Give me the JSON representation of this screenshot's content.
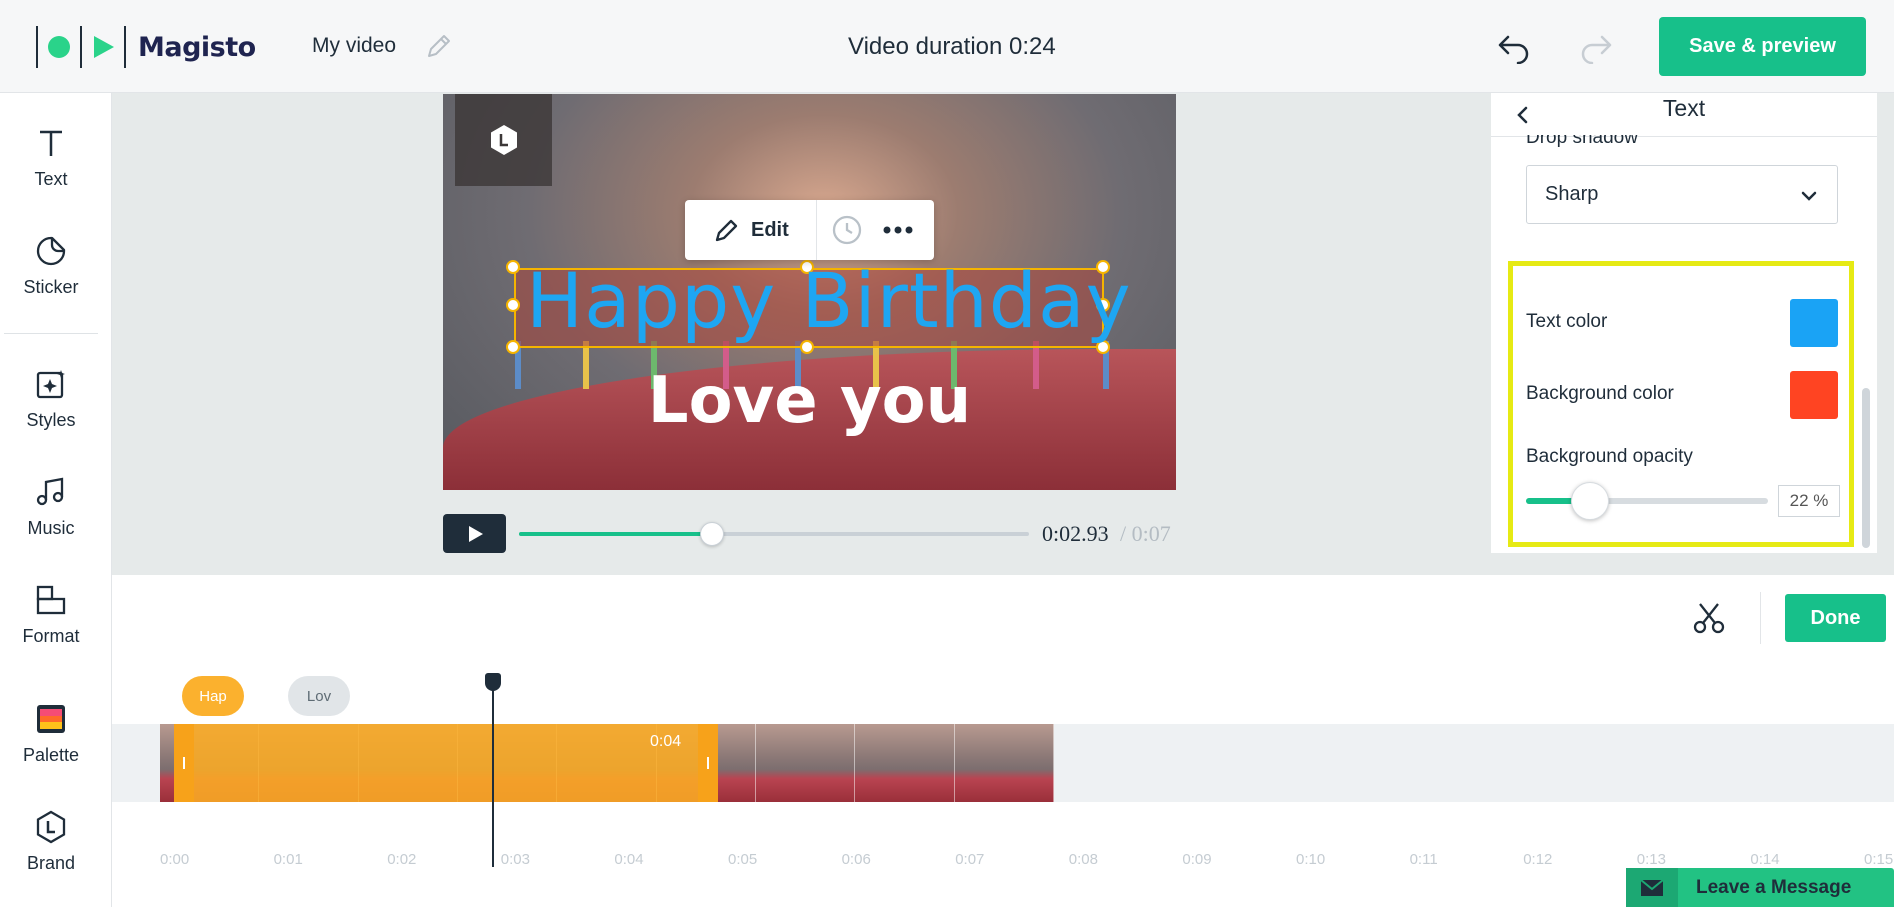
{
  "header": {
    "brand": "Magisto",
    "video_title": "My video",
    "duration": "Video duration 0:24",
    "save_label": "Save & preview",
    "accent": "#17c08a"
  },
  "toolbar": {
    "items": [
      {
        "label": "Text",
        "icon": "text-icon"
      },
      {
        "label": "Sticker",
        "icon": "sticker-icon"
      },
      {
        "label": "Styles",
        "icon": "styles-icon"
      },
      {
        "label": "Music",
        "icon": "music-icon"
      },
      {
        "label": "Format",
        "icon": "format-icon"
      },
      {
        "label": "Palette",
        "icon": "palette-icon"
      },
      {
        "label": "Brand",
        "icon": "brand-icon"
      }
    ]
  },
  "preview": {
    "edit_label": "Edit",
    "main_text": "Happy Birthday",
    "secondary_text": "Love you",
    "current_time": "0:02.93",
    "total_time": " / 0:07",
    "progress": 0.38
  },
  "panel": {
    "title": "Text",
    "drop_shadow_label": "Drop shadow",
    "drop_shadow_value": "Sharp",
    "text_color_label": "Text color",
    "text_color": "#1aa3f5",
    "background_color_label": "Background color",
    "background_color": "#ff4422",
    "background_opacity_label": "Background opacity",
    "background_opacity": "22",
    "percent_sign": "%"
  },
  "timeline": {
    "done_label": "Done",
    "clips": [
      {
        "label": "Hap",
        "color": "#fbb12e"
      },
      {
        "label": "Lov",
        "color": "#e1e5e8"
      }
    ],
    "selected_clip_duration": "0:04",
    "ruler": [
      "0:00",
      "0:01",
      "0:02",
      "0:03",
      "0:04",
      "0:05",
      "0:06",
      "0:07",
      "0:08",
      "0:09",
      "0:10",
      "0:11",
      "0:12",
      "0:13",
      "0:14",
      "0:15"
    ]
  },
  "chat": {
    "label": "Leave a Message"
  }
}
